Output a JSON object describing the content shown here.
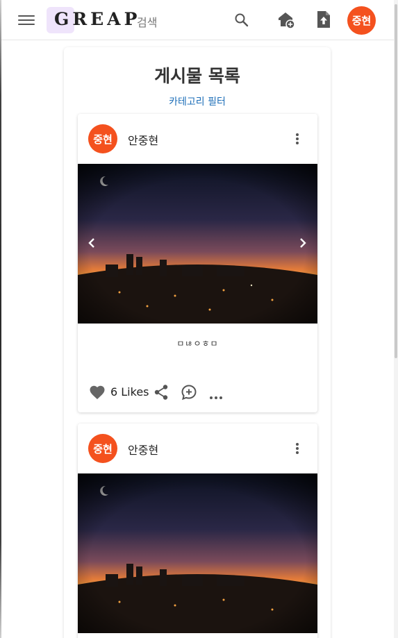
{
  "header": {
    "logo_text": "GREAP",
    "search_label": "검색",
    "profile_initials": "중현",
    "icons": {
      "menu": "menu-icon",
      "search": "search-icon",
      "home_add": "home-add-icon",
      "upload": "upload-file-icon"
    }
  },
  "main": {
    "title": "게시물 목록",
    "category_filter": "카테고리 필터"
  },
  "posts": [
    {
      "avatar_initials": "중현",
      "author": "안중현",
      "caption": "ㅁㄶㅇㅎㅁ",
      "likes_label": "6 Likes"
    },
    {
      "avatar_initials": "중현",
      "author": "안중현"
    }
  ],
  "colors": {
    "avatar_bg": "#f4511e",
    "logo_bg": "#efe4fb",
    "link": "#1e6fb8"
  }
}
